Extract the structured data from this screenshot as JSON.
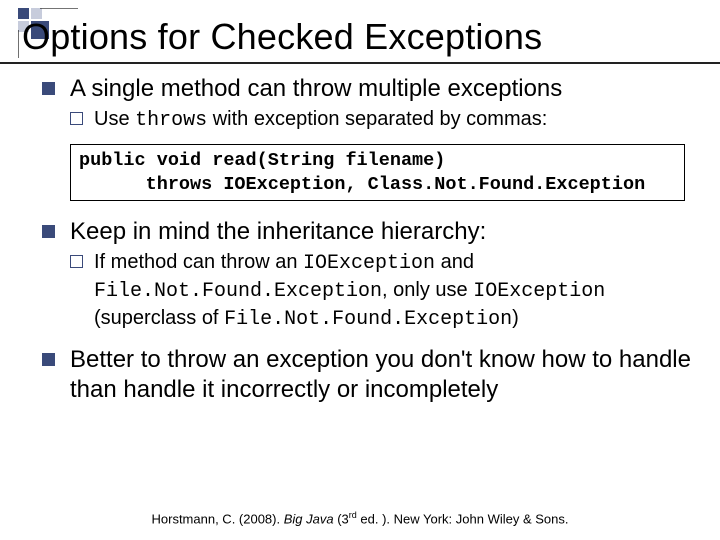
{
  "title": "Options for Checked Exceptions",
  "bullets": [
    {
      "text": "A single method can throw multiple exceptions",
      "sub_prefix": "Use ",
      "sub_code": "throws",
      "sub_suffix": " with exception separated by commas:"
    },
    {
      "code": "public void read(String filename)\n      throws IOException, Class.Not.Found.Exception"
    },
    {
      "text": "Keep in mind the inheritance hierarchy:",
      "sub_prefix": "If method can throw an ",
      "sub_code1": "IOException",
      "sub_mid1": " and ",
      "sub_code2": "File.Not.Found.Exception",
      "sub_mid2": ", only use ",
      "sub_code3": "IOException",
      "sub_mid3": " (superclass of ",
      "sub_code4": "File.Not.Found.Exception",
      "sub_end": ")"
    },
    {
      "text": "Better to throw an exception you don't know how to handle than handle it incorrectly or incompletely"
    }
  ],
  "footer": {
    "author": "Horstmann, C. (2008). ",
    "title": "Big Java",
    "edition_open": " (3",
    "edition_sup": "rd",
    "edition_close": " ed. ). New York: John Wiley & Sons."
  }
}
